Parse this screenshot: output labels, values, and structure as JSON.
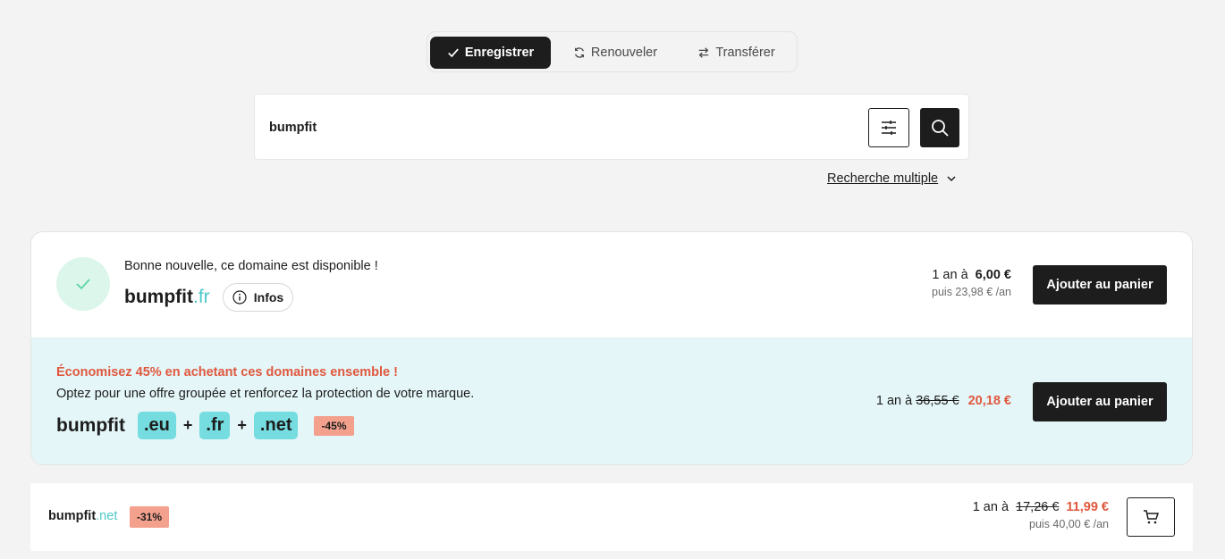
{
  "tabs": [
    {
      "label": "Enregistrer",
      "icon": "check-icon",
      "active": true
    },
    {
      "label": "Renouveler",
      "icon": "refresh-icon",
      "active": false
    },
    {
      "label": "Transférer",
      "icon": "transfer-icon",
      "active": false
    }
  ],
  "search": {
    "value": "bumpfit",
    "placeholder": ""
  },
  "multi_search_label": "Recherche multiple",
  "result": {
    "message": "Bonne nouvelle, ce domaine est disponible !",
    "domain_name": "bumpfit",
    "domain_tld": ".fr",
    "infos_label": "Infos",
    "price_prefix": "1 an à",
    "price": "6,00 €",
    "renewal": "puis 23,98 € /an",
    "cart_label": "Ajouter au panier"
  },
  "bundle": {
    "title": "Économisez 45% en achetant ces domaines ensemble !",
    "subtitle": "Optez pour une offre groupée et renforcez la protection de votre marque.",
    "name": "bumpfit",
    "tlds": [
      ".eu",
      ".fr",
      ".net"
    ],
    "plus": "+",
    "discount": "-45%",
    "price_prefix": "1 an à",
    "old_price": "36,55 €",
    "new_price": "20,18 €",
    "cart_label": "Ajouter au panier"
  },
  "alt": {
    "domain_name": "bumpfit",
    "domain_tld": ".net",
    "discount": "-31%",
    "price_prefix": "1 an à",
    "old_price": "17,26 €",
    "new_price": "11,99 €",
    "renewal": "puis 40,00 € /an"
  },
  "colors": {
    "accent_teal": "#4cc8c8",
    "chip_teal": "#75dcdf",
    "sale_red": "#e0583e",
    "dark": "#1d1d1d"
  }
}
